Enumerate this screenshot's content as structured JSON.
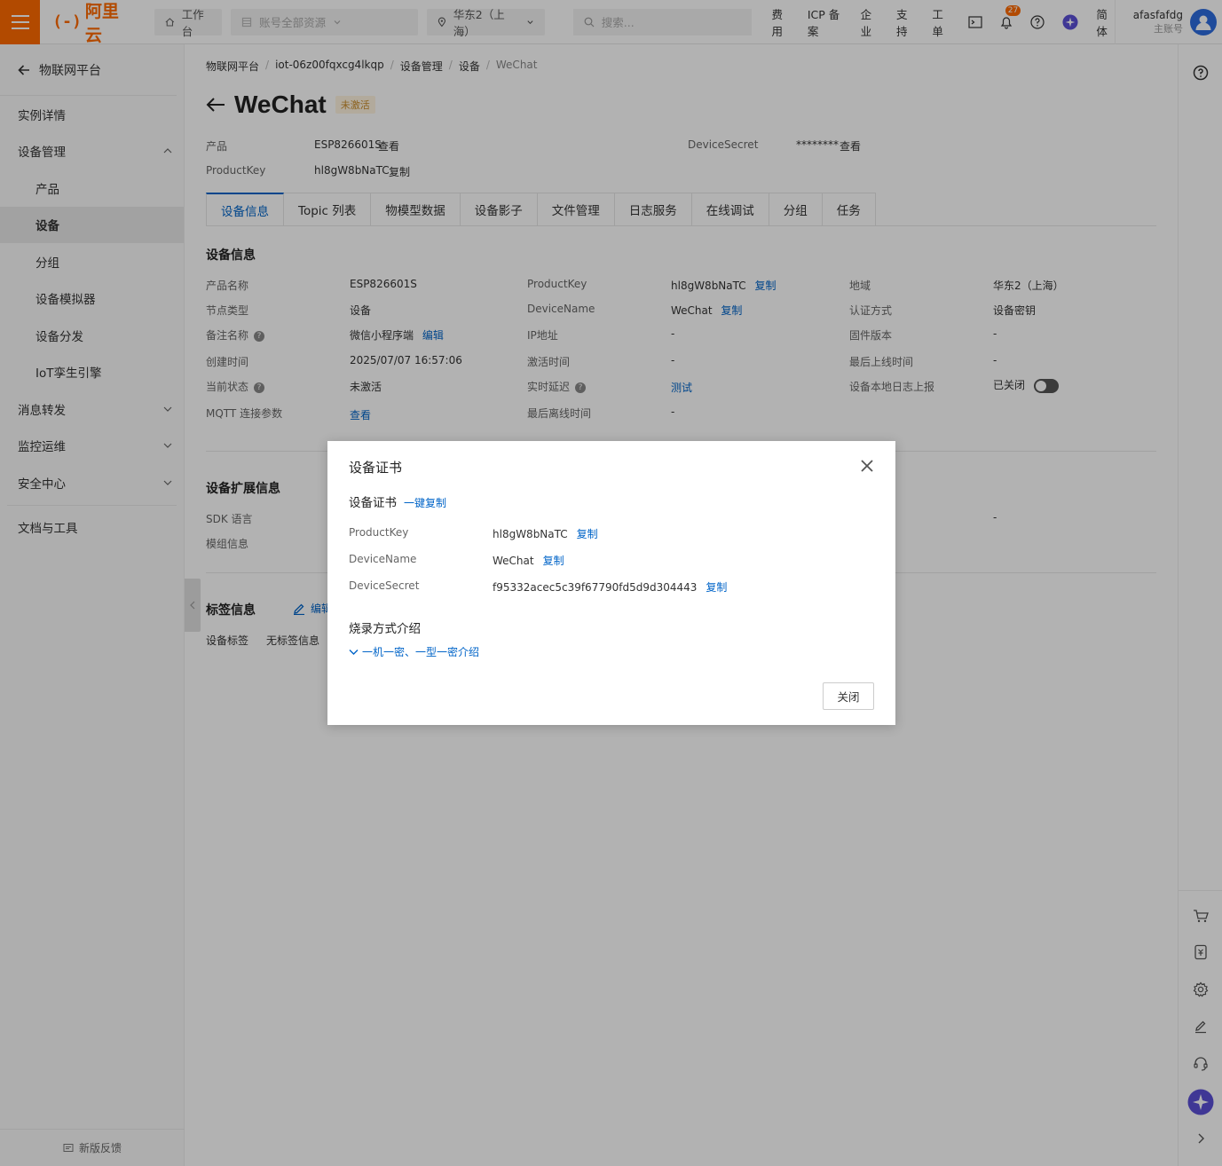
{
  "topbar": {
    "logo_text": "阿里云",
    "workbench": "工作台",
    "account_resources": "账号全部资源",
    "region": "华东2（上海）",
    "search_placeholder": "搜索...",
    "links": [
      "费用",
      "ICP 备案",
      "企业",
      "支持",
      "工单"
    ],
    "notification_count": "27",
    "language": "简体",
    "username": "afasfafdg",
    "account_type": "主账号",
    "brand_color": "#ff6a00"
  },
  "sidebar": {
    "back_title": "物联网平台",
    "items": [
      {
        "label": "实例详情"
      },
      {
        "label": "设备管理"
      },
      {
        "label": "产品"
      },
      {
        "label": "设备"
      },
      {
        "label": "分组"
      },
      {
        "label": "设备模拟器"
      },
      {
        "label": "设备分发"
      },
      {
        "label": "IoT孪生引擎"
      },
      {
        "label": "消息转发"
      },
      {
        "label": "监控运维"
      },
      {
        "label": "安全中心"
      },
      {
        "label": "文档与工具"
      }
    ],
    "feedback": "新版反馈"
  },
  "breadcrumb": [
    "物联网平台",
    "iot-06z00fqxcg4lkqp",
    "设备管理",
    "设备",
    "WeChat"
  ],
  "device": {
    "name": "WeChat",
    "status_tag": "未激活",
    "product_label": "产品",
    "product_value": "ESP826601S",
    "product_action": "查看",
    "productkey_label": "ProductKey",
    "productkey_value": "hl8gW8bNaTC",
    "copy": "复制",
    "secret_label": "DeviceSecret",
    "secret_value": "********",
    "secret_action": "查看"
  },
  "tabs": [
    "设备信息",
    "Topic 列表",
    "物模型数据",
    "设备影子",
    "文件管理",
    "日志服务",
    "在线调试",
    "分组",
    "任务"
  ],
  "info": {
    "section_title": "设备信息",
    "col1": [
      {
        "k": "产品名称",
        "v": "ESP826601S"
      },
      {
        "k": "节点类型",
        "v": "设备"
      },
      {
        "k": "备注名称",
        "v": "微信小程序端",
        "action": "编辑"
      },
      {
        "k": "创建时间",
        "v": "2025/07/07 16:57:06"
      },
      {
        "k": "当前状态",
        "v": "未激活"
      },
      {
        "k": "MQTT 连接参数",
        "v": "查看"
      }
    ],
    "col2": [
      {
        "k": "ProductKey",
        "v": "hl8gW8bNaTC",
        "action": "复制"
      },
      {
        "k": "DeviceName",
        "v": "WeChat",
        "action": "复制"
      },
      {
        "k": "IP地址",
        "v": "-"
      },
      {
        "k": "激活时间",
        "v": "-"
      },
      {
        "k": "实时延迟",
        "v": "测试"
      },
      {
        "k": "最后离线时间",
        "v": "-"
      }
    ],
    "col3": [
      {
        "k": "地域",
        "v": "华东2（上海）"
      },
      {
        "k": "认证方式",
        "v": "设备密钥"
      },
      {
        "k": "固件版本",
        "v": "-"
      },
      {
        "k": "最后上线时间",
        "v": "-"
      },
      {
        "k": "设备本地日志上报",
        "v": "已关闭"
      }
    ]
  },
  "ext": {
    "section_title": "设备扩展信息",
    "sdk_label": "SDK 语言",
    "module_label": "模组信息",
    "right_value": "-"
  },
  "tags": {
    "section_title": "标签信息",
    "edit": "编辑",
    "label": "设备标签",
    "value": "无标签信息"
  },
  "modal": {
    "title": "设备证书",
    "subtitle": "设备证书",
    "copy_all": "一键复制",
    "rows": [
      {
        "k": "ProductKey",
        "v": "hl8gW8bNaTC",
        "action": "复制"
      },
      {
        "k": "DeviceName",
        "v": "WeChat",
        "action": "复制"
      },
      {
        "k": "DeviceSecret",
        "v": "f95332acec5c39f67790fd5d9d304443",
        "action": "复制"
      }
    ],
    "burn_title": "烧录方式介绍",
    "burn_link": "一机一密、一型一密介绍",
    "close_button": "关闭"
  }
}
